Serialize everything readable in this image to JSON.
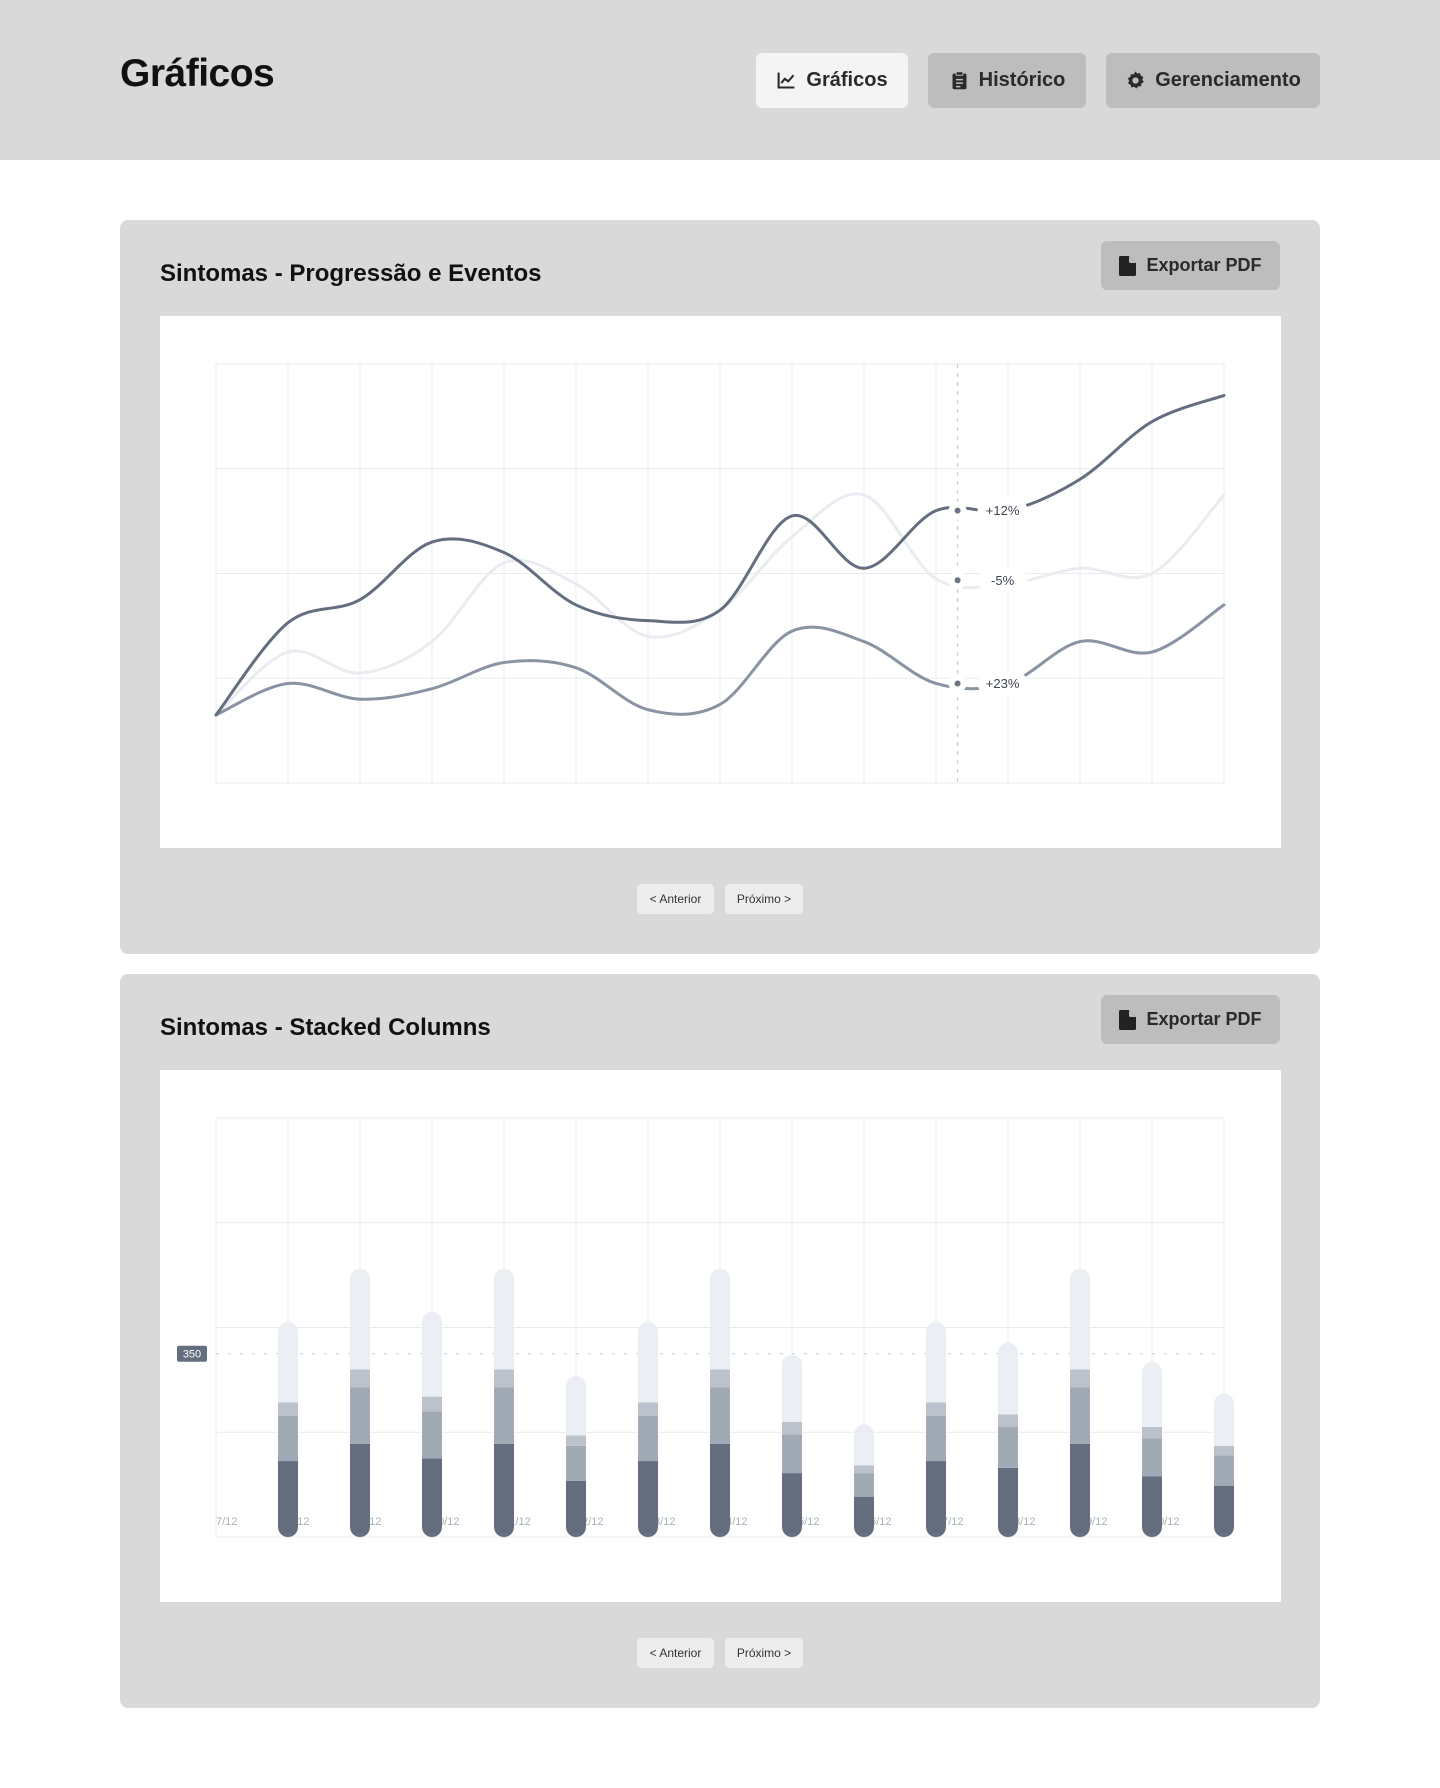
{
  "header": {
    "title": "Gráficos",
    "nav": [
      {
        "label": "Gráficos",
        "icon": "chart-line-icon",
        "active": true
      },
      {
        "label": "Histórico",
        "icon": "clipboard-icon",
        "active": false
      },
      {
        "label": "Gerenciamento",
        "icon": "gear-icon",
        "active": false
      }
    ]
  },
  "cards": [
    {
      "title": "Sintomas - Progressão e Eventos",
      "export_label": "Exportar PDF",
      "export_icon": "file-icon",
      "prev_label": "< Anterior",
      "next_label": "Próximo >"
    },
    {
      "title": "Sintomas - Stacked Columns",
      "export_label": "Exportar PDF",
      "export_icon": "file-icon",
      "prev_label": "< Anterior",
      "next_label": "Próximo >"
    }
  ],
  "colors": {
    "series_dark": "#646e7e",
    "series_mid": "#8993a2",
    "series_light": "#e9ecf0",
    "stack_dark": "#646e7e",
    "stack_mid": "#a1a9b5",
    "stack_light2": "#bcc2cb",
    "stack_light": "#ebeef2",
    "grid": "#e9ebee"
  },
  "chart_data": [
    {
      "type": "line",
      "title": "Sintomas - Progressão e Eventos",
      "x_count": 15,
      "ylim": [
        0,
        4
      ],
      "grid": true,
      "series": [
        {
          "color_key": "series_dark",
          "values": [
            0.65,
            1.53,
            1.75,
            2.3,
            2.2,
            1.7,
            1.55,
            1.65,
            2.55,
            2.05,
            2.6,
            2.6,
            2.9,
            3.45,
            3.7
          ]
        },
        {
          "color_key": "series_light",
          "values": [
            0.65,
            1.25,
            1.05,
            1.35,
            2.1,
            1.9,
            1.4,
            1.65,
            2.35,
            2.75,
            1.95,
            1.9,
            2.05,
            2.0,
            2.75
          ]
        },
        {
          "color_key": "series_mid",
          "values": [
            0.65,
            0.95,
            0.8,
            0.9,
            1.15,
            1.1,
            0.7,
            0.75,
            1.45,
            1.35,
            0.95,
            0.95,
            1.35,
            1.25,
            1.7
          ]
        }
      ],
      "marker_index": 10.3,
      "annotations": [
        {
          "text": "+12%",
          "series": 0
        },
        {
          "text": "-5%",
          "series": 1
        },
        {
          "text": "+23%",
          "series": 2
        }
      ]
    },
    {
      "type": "bar",
      "stacked": true,
      "title": "Sintomas - Stacked Columns",
      "categories": [
        "7/12",
        "8/12",
        "9/12",
        "10/12",
        "11/12",
        "12/12",
        "13/12",
        "14/12",
        "15/12",
        "16/12",
        "17/12",
        "18/12",
        "19/12",
        "20/12"
      ],
      "ylim": [
        0,
        800
      ],
      "reference_line": {
        "value": 350,
        "label": "350"
      },
      "series": [
        {
          "color_key": "stack_dark",
          "values": [
            145,
            178,
            150,
            178,
            107,
            145,
            178,
            122,
            77,
            145,
            132,
            178,
            116,
            98
          ]
        },
        {
          "color_key": "stack_mid",
          "values": [
            86,
            108,
            90,
            108,
            67,
            86,
            108,
            74,
            45,
            86,
            78,
            108,
            72,
            58
          ]
        },
        {
          "color_key": "stack_light2",
          "values": [
            26,
            34,
            28,
            34,
            20,
            26,
            34,
            24,
            15,
            26,
            24,
            34,
            22,
            18
          ]
        },
        {
          "color_key": "stack_light",
          "values": [
            153,
            192,
            162,
            192,
            113,
            153,
            192,
            128,
            78,
            153,
            137,
            192,
            124,
            100
          ]
        }
      ]
    }
  ]
}
